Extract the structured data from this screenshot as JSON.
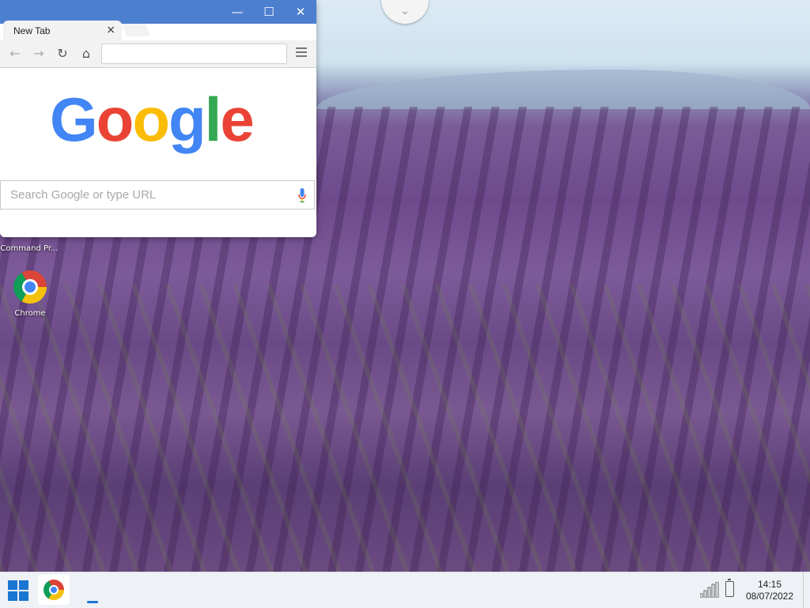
{
  "browser": {
    "tab_title": "New Tab",
    "tab_close": "×",
    "window_controls": {
      "minimize": "—",
      "maximize": "☐",
      "close": "✕"
    },
    "toolbar": {
      "back": "←",
      "forward": "→",
      "reload": "↻",
      "home": "⌂"
    },
    "omnibox_value": "",
    "logo_letters": [
      "G",
      "o",
      "o",
      "g",
      "l",
      "e"
    ],
    "logo_colors": [
      "#4285F4",
      "#EA4335",
      "#FBBC05",
      "#4285F4",
      "#34A853",
      "#EA4335"
    ],
    "search_placeholder": "Search Google or type URL",
    "icons": [
      "back-arrow-icon",
      "forward-arrow-icon",
      "reload-icon",
      "home-icon",
      "menu-icon",
      "microphone-icon"
    ]
  },
  "desktop": {
    "icons": [
      {
        "label": "Command Pr...",
        "icon": "command-prompt-icon"
      },
      {
        "label": "Chrome",
        "icon": "chrome-icon"
      }
    ],
    "pull_tab_glyph": "⌄"
  },
  "taskbar": {
    "time": "14:15",
    "date": "08/07/2022",
    "accent": "#1976D2",
    "icons": [
      "windows-start-icon",
      "chrome-icon",
      "signal-icon",
      "battery-icon"
    ]
  }
}
